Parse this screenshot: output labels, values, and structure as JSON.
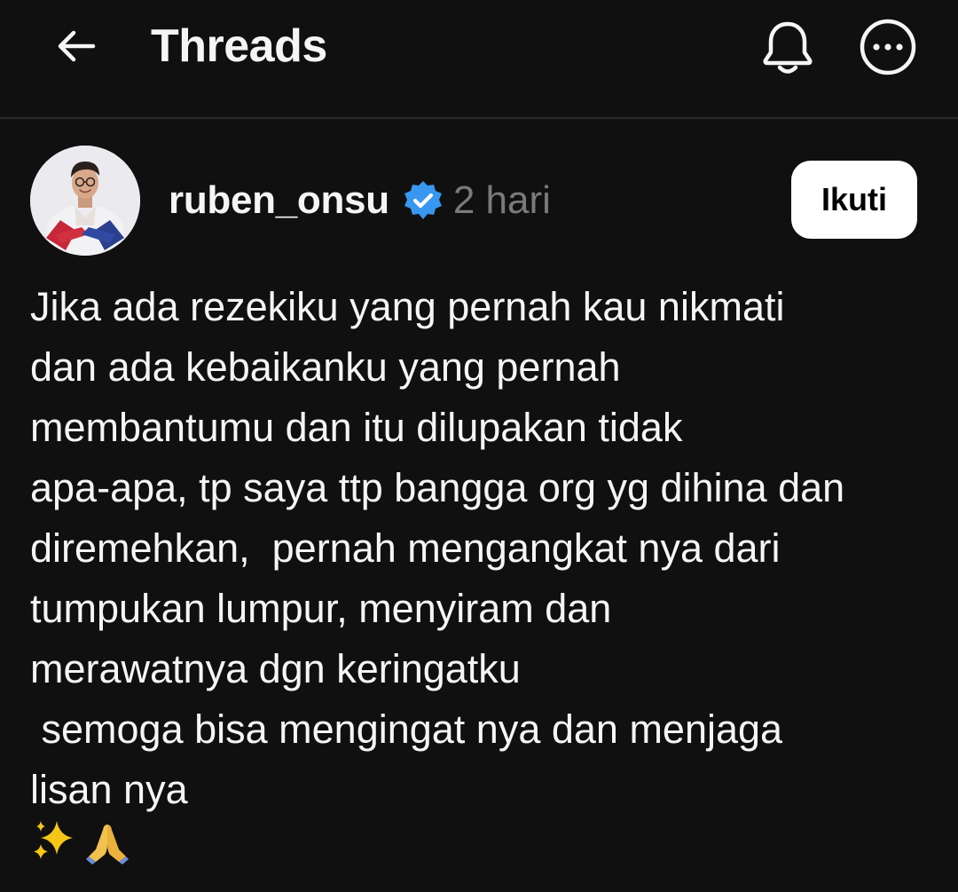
{
  "header": {
    "back_icon": "arrow-left-icon",
    "title": "Threads",
    "bell_icon": "bell-icon",
    "more_icon": "more-horizontal-circle-icon"
  },
  "post": {
    "avatar_icon": "profile-photo",
    "username": "ruben_onsu",
    "verified_icon": "verified-badge-icon",
    "verified_color": "#3897f0",
    "timestamp": "2 hari",
    "follow_label": "Ikuti",
    "lines": [
      "Jika ada rezekiku yang pernah kau nikmati",
      "dan ada kebaikanku yang pernah",
      "membantumu dan itu dilupakan tidak",
      "apa-apa, tp saya ttp bangga org yg dihina dan",
      "diremehkan,  pernah mengangkat nya dari",
      "tumpukan lumpur, menyiram dan",
      "merawatnya dgn keringatku",
      " semoga bisa mengingat nya dan menjaga",
      "lisan nya"
    ],
    "emoji": [
      "sparkles-emoji",
      "folded-hands-emoji"
    ]
  },
  "colors": {
    "background": "#101010",
    "text": "#f3f5f7",
    "muted": "#7a7a7a",
    "divider": "#2a2a2a"
  }
}
